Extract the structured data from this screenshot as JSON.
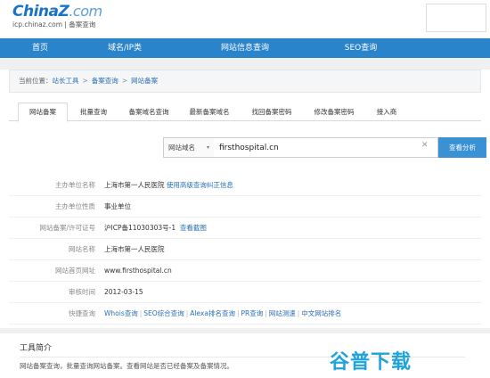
{
  "header": {
    "logo_china": "China",
    "logo_z": "Z",
    "logo_com": ".com",
    "logo_sub": "icp.chinaz.com | 备案查询"
  },
  "nav": [
    "首页",
    "域名/IP类",
    "网站信息查询",
    "SEO查询"
  ],
  "breadcrumb": {
    "prefix": "当前位置：",
    "items": [
      "站长工具",
      "备案查询",
      "网站备案"
    ],
    "sep": ">"
  },
  "tabs": [
    "网站备案",
    "批量查询",
    "备案域名查询",
    "最新备案域名",
    "找回备案密码",
    "修改备案密码",
    "接入商"
  ],
  "search": {
    "select_label": "网站域名",
    "select_arrow": "▾",
    "value": "firsthospital.cn",
    "clear": "✕",
    "button": "查看分析"
  },
  "rows": [
    {
      "key": "主办单位名称",
      "value": "上海市第一人民医院",
      "link": "使用高级查询纠正信息"
    },
    {
      "key": "主办单位性质",
      "value": "事业单位"
    },
    {
      "key": "网站备案/许可证号",
      "value": "沪ICP备11030303号-1",
      "link": "查看截图"
    },
    {
      "key": "网站名称",
      "value": "上海市第一人民医院"
    },
    {
      "key": "网站首页网址",
      "value": "www.firsthospital.cn"
    },
    {
      "key": "审核时间",
      "value": "2012-03-15"
    },
    {
      "key": "快捷查询",
      "links": [
        "Whois查询",
        "SEO综合查询",
        "Alexa排名查询",
        "PR查询",
        "网站测速",
        "中文网站排名"
      ]
    }
  ],
  "tool": {
    "title": "工具简介",
    "desc": "网站备案查询，批量查询网站备案。查看网站是否已经备案及备案情况。"
  },
  "watermark": "谷普下载",
  "colors": {
    "nav": "#2a84cc",
    "link": "#2a6fb5",
    "button": "#3a91d3",
    "watermark": "#1fa3dd"
  }
}
